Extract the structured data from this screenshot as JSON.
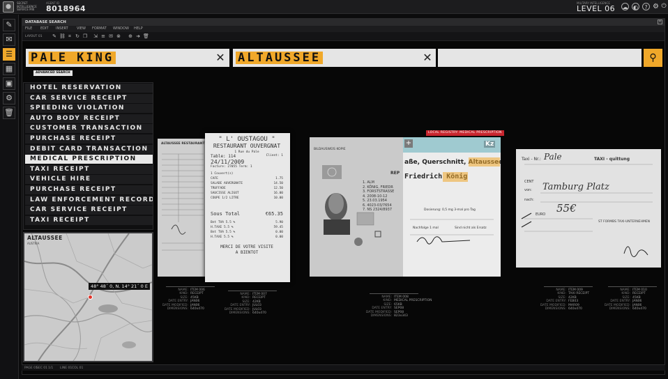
{
  "topbar": {
    "agency": "SECRET INTELLIGENCE SERVICE MI6",
    "agent_caption": "AGENT ID",
    "agent_id": "8018964",
    "level_caption": "MILITARY INTELLIGENCE",
    "level": "LEVEL 06",
    "icons": [
      "cloud-icon",
      "mask-icon",
      "help-icon",
      "settings-icon",
      "power-icon"
    ]
  },
  "dock": {
    "items": [
      {
        "name": "edit-icon",
        "glyph": "✎",
        "active": false
      },
      {
        "name": "mail-icon",
        "glyph": "✉",
        "active": false
      },
      {
        "name": "list-icon",
        "glyph": "☰",
        "active": true
      },
      {
        "name": "calendar-icon",
        "glyph": "▦",
        "active": false
      },
      {
        "name": "grid-icon",
        "glyph": "▣",
        "active": false
      },
      {
        "name": "settings-icon",
        "glyph": "⚙",
        "active": false
      },
      {
        "name": "trash-icon",
        "glyph": "🗑",
        "active": false
      }
    ]
  },
  "window": {
    "title": "DATABASE SEARCH",
    "menu": [
      "FILE",
      "EDIT",
      "INSERT",
      "VIEW",
      "FORMAT",
      "WINDOW",
      "HELP"
    ],
    "layout_label": "LAYOUT 01",
    "tools": [
      "pen-icon",
      "link-icon",
      "crop-icon",
      "rotate-icon",
      "copy-icon",
      "export-icon",
      "layers-icon",
      "mail-icon",
      "delete-icon",
      "add-icon",
      "next-icon",
      "trash-icon"
    ]
  },
  "search": {
    "fields": [
      {
        "label": "SEARCH FIELD 01",
        "value": "PALE KING"
      },
      {
        "label": "SEARCH FIELD 02",
        "value": "ALTAUSSEE"
      },
      {
        "label": "SEARCH FIELD 03",
        "value": ""
      }
    ],
    "advanced_label": "ADVANCED SEARCH"
  },
  "doc_types": {
    "items": [
      "HOTEL RESERVATION",
      "CAR SERVICE RECEIPT",
      "SPEEDING VIOLATION",
      "AUTO BODY RECEIPT",
      "CUSTOMER TRANSACTION",
      "PURCHASE RECEIPT",
      "DEBIT CARD TRANSACTION",
      "MEDICAL PRESCRIPTION",
      "TAXI RECEIPT",
      "VEHICLE HIRE",
      "PURCHASE RECEIPT",
      "LAW ENFORCEMENT RECORDS",
      "CAR SERVICE RECEIPT",
      "TAXI RECEIPT"
    ],
    "selected_index": 7
  },
  "map": {
    "title": "ALTAUSSEE",
    "subtitle": "AUSTRIA",
    "coords": "48° 48´ 0, N. 14° 21´ 0 E"
  },
  "cards": {
    "receipt_a_title": "ALTAUSSEE RESTAURANT",
    "receipt": {
      "header1": "\" L' OUSTAGOU \"",
      "header2": "RESTAURANT OUVERGNAT",
      "address": "1 Rue du Pale",
      "table": "Table: 114",
      "client": "Client: 1",
      "date": "24/11/2009",
      "facture": "Facture: 27055  Term: 1",
      "items": [
        [
          "1 Couvert(s)",
          ""
        ],
        [
          "CAFE",
          "1.75"
        ],
        [
          "SALADE AUVERGNATE",
          "14.50"
        ],
        [
          "TRUFFADE",
          "12.50"
        ],
        [
          "SAUCISSE ALIGOT",
          "16.00"
        ],
        [
          "COUPE 1/2 LITRE",
          "10.00"
        ]
      ],
      "sous_total_label": "Sous Total",
      "sous_total": "€65.35",
      "taxes": [
        [
          "Bnt TVA  5.5 %",
          "5.90"
        ],
        [
          "H.TAXE 5.5 %",
          "59.45"
        ],
        [
          "Bnt TVA  5.5 %",
          "0.00"
        ],
        [
          "H.TAXE  5.5 %",
          "0.00"
        ]
      ],
      "thanks1": "MERCI DE VOTRE VISITE",
      "thanks2": "A BIENTOT"
    },
    "id_badge": "LOCAL REGISTRY: MEDICAL PRESCRIPTION",
    "id_left_title": "BILDAUSWEIS KOPIE",
    "id_rep": "REP",
    "id_lines": [
      "1. ALM",
      "2. KÖNIG, FRIEDR",
      "3. FORSTSTRASSE",
      "4. 2008-10-12",
      "5. 23.03.1954",
      "6. 4023-03/7654",
      "7. NS 2324/8937"
    ],
    "id_right_header": "Kz",
    "id_name_line": "aße, Querschnitt, Altaussee",
    "id_name": "Friedrich König",
    "id_dosage": "Dosierung: 0,5 mg 3-mal pro Tag",
    "id_nachfolge": "Nachfolge  1  mal",
    "id_ersatz": "Sind nicht als Ersatz",
    "taxi": {
      "nr_label": "Taxi - Nr.:",
      "nr_value": "Pale",
      "header": "TAXI -  quittung",
      "from_label": "von:",
      "from_value": "Tamburg Platz",
      "to_label": "nach:",
      "price": "55€",
      "euro": "EURO",
      "cent": "CENT",
      "footer": "ST FORMBS TAXI-UNTERNEHMEN"
    }
  },
  "meta": {
    "blocks": [
      [
        [
          "NAME:",
          "ITEM 006"
        ],
        [
          "KIND:",
          "RECEIPT"
        ],
        [
          "SIZE:",
          "45KB"
        ],
        [
          "DATE ENTRY:",
          "JAN06"
        ],
        [
          "DATE MODIFIED:",
          "JAN06"
        ],
        [
          "DIMENSIONS:",
          "640x470"
        ]
      ],
      [
        [
          "NAME:",
          "ITEM 007"
        ],
        [
          "KIND:",
          "RECEIPT"
        ],
        [
          "SIZE:",
          "42KB"
        ],
        [
          "DATE ENTRY:",
          "JUL03"
        ],
        [
          "DATE MODIFIED:",
          "JUL03"
        ],
        [
          "DIMENSIONS:",
          "640x470"
        ]
      ],
      [
        [
          "NAME:",
          "ITEM 008"
        ],
        [
          "KIND:",
          "MEDICAL PRESCRIPTION"
        ],
        [
          "SIZE:",
          "65KB"
        ],
        [
          "DATE ENTRY:",
          "SEP08"
        ],
        [
          "DATE MODIFIED:",
          "SEP08"
        ],
        [
          "DIMENSIONS:",
          "823x343"
        ]
      ],
      [
        [
          "NAME:",
          "ITEM 009"
        ],
        [
          "KIND:",
          "TAXI RECEIPT"
        ],
        [
          "SIZE:",
          "42KB"
        ],
        [
          "DATE ENTRY:",
          "FEB03"
        ],
        [
          "DATE MODIFIED:",
          "MAR09"
        ],
        [
          "DIMENSIONS:",
          "640x470"
        ]
      ],
      [
        [
          "NAME:",
          "ITEM 010"
        ],
        [
          "KIND:",
          "RECEIPT"
        ],
        [
          "SIZE:",
          "45KB"
        ],
        [
          "DATE ENTRY:",
          "JAN06"
        ],
        [
          "DATE MODIFIED:",
          "JAN06"
        ],
        [
          "DIMENSIONS:",
          "640x470"
        ]
      ]
    ]
  },
  "status": {
    "items": [
      "PAGE 01",
      "SEC 01",
      "1/1",
      "LINE 01",
      "COL 01"
    ]
  }
}
